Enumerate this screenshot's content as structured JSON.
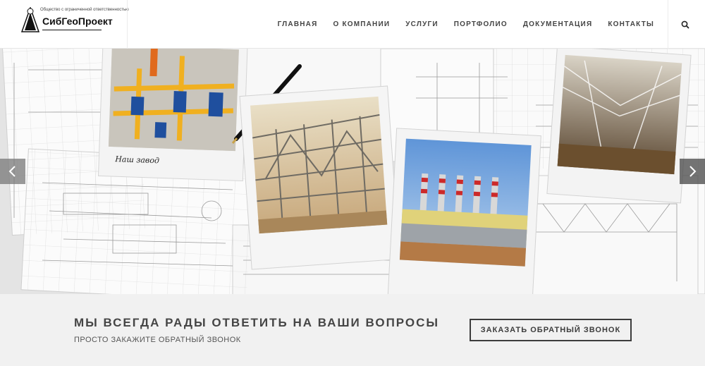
{
  "logo": {
    "tagline": "Общество с ограниченной ответственностью",
    "name": "СибГеоПроект"
  },
  "nav": {
    "items": [
      "ГЛАВНАЯ",
      "О КОМПАНИИ",
      "УСЛУГИ",
      "ПОРТФОЛИО",
      "ДОКУМЕНТАЦИЯ",
      "КОНТАКТЫ"
    ]
  },
  "hero": {
    "photo_caption": "Наш завод"
  },
  "cta": {
    "heading": "МЫ ВСЕГДА РАДЫ ОТВЕТИТЬ НА ВАШИ ВОПРОСЫ",
    "subtext": "ПРОСТО ЗАКАЖИТЕ ОБРАТНЫЙ ЗВОНОК",
    "button": "ЗАКАЗАТЬ ОБРАТНЫЙ ЗВОНОК"
  },
  "colors": {
    "header_bg": "#ffffff",
    "cta_bg": "#f1f1f1",
    "text_dark": "#454545",
    "arrow_bg": "#6e6e6e"
  },
  "icons": {
    "search": "search-icon",
    "prev": "chevron-left-icon",
    "next": "chevron-right-icon",
    "logo": "triangle-logo-icon"
  }
}
